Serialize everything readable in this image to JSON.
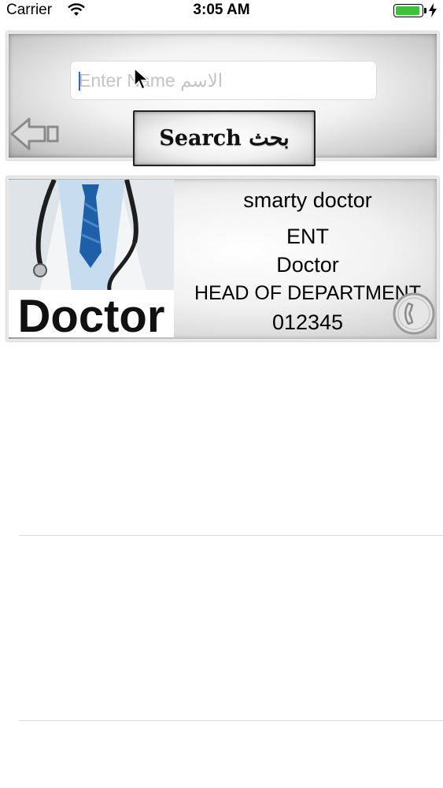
{
  "status_bar": {
    "carrier": "Carrier",
    "time": "3:05 AM",
    "battery_level": 0.95,
    "battery_color": "#3fc13f"
  },
  "search": {
    "placeholder": "Enter Name الاسم",
    "value": "",
    "button_label": "Search بحث"
  },
  "results": [
    {
      "photo_caption": "Doctor",
      "name": "smarty doctor",
      "specialty": "ENT",
      "title": "Doctor",
      "position": "HEAD OF DEPARTMENT",
      "phone": "012345"
    }
  ],
  "icons": {
    "back": "back-arrow-icon",
    "call": "phone-icon",
    "wifi": "wifi-icon",
    "charging": "charging-bolt-icon"
  }
}
